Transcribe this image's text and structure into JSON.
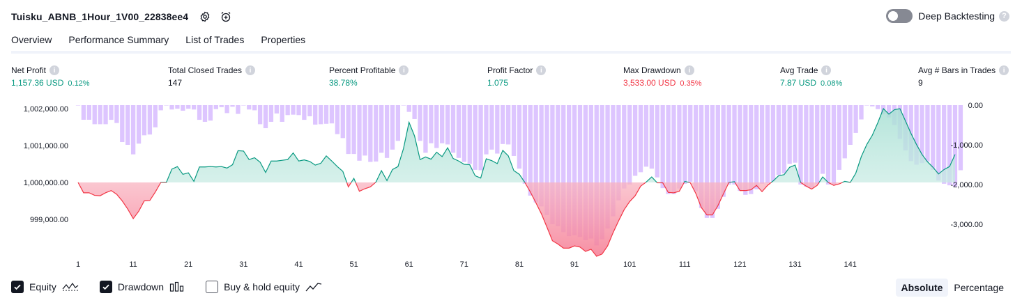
{
  "header": {
    "title": "Tuisku_ABNB_1Hour_1V00_22838ee4",
    "deep_backtesting_label": "Deep Backtesting",
    "info_glyph": "?"
  },
  "tabs": [
    {
      "label": "Overview",
      "active": true
    },
    {
      "label": "Performance Summary",
      "active": false
    },
    {
      "label": "List of Trades",
      "active": false
    },
    {
      "label": "Properties",
      "active": false
    }
  ],
  "metrics": [
    {
      "label": "Net Profit",
      "value": "1,157.36 USD",
      "sub": "0.12%",
      "color": "green"
    },
    {
      "label": "Total Closed Trades",
      "value": "147",
      "sub": "",
      "color": "dark"
    },
    {
      "label": "Percent Profitable",
      "value": "38.78%",
      "sub": "",
      "color": "green"
    },
    {
      "label": "Profit Factor",
      "value": "1.075",
      "sub": "",
      "color": "green"
    },
    {
      "label": "Max Drawdown",
      "value": "3,533.00 USD",
      "sub": "0.35%",
      "color": "red"
    },
    {
      "label": "Avg Trade",
      "value": "7.87 USD",
      "sub": "0.08%",
      "color": "green"
    },
    {
      "label": "Avg # Bars in Trades",
      "value": "9",
      "sub": "",
      "color": "dark"
    }
  ],
  "legend": {
    "equity_label": "Equity",
    "drawdown_label": "Drawdown",
    "buyhold_label": "Buy & hold equity",
    "equity_checked": true,
    "drawdown_checked": true,
    "buyhold_checked": false
  },
  "mode": {
    "absolute_label": "Absolute",
    "percentage_label": "Percentage",
    "active": "Absolute"
  },
  "colors": {
    "equity_up": "#089981",
    "equity_down": "#f23645",
    "equity_fill_up": "#d7f0ea",
    "equity_fill_down": "#f8b8c3",
    "drawdown_bar": "#d5b6ff",
    "text": "#131722"
  },
  "chart_data": {
    "type": "line",
    "title": "",
    "xlabel": "",
    "ylabel": "",
    "x_ticks": [
      "1",
      "11",
      "21",
      "31",
      "41",
      "51",
      "61",
      "71",
      "81",
      "91",
      "101",
      "111",
      "121",
      "131",
      "141"
    ],
    "equity_axis": {
      "ticks": [
        999000,
        1000000,
        1001000,
        1002000
      ],
      "tick_labels": [
        "999,000.00",
        "1,000,000.00",
        "1,001,000.00",
        "1,002,000.00"
      ],
      "ylim": [
        998000,
        1002200
      ]
    },
    "drawdown_axis": {
      "ticks": [
        0,
        -1000,
        -2000,
        -3000
      ],
      "tick_labels": [
        "0.00",
        "-1,000.00",
        "-2,000.00",
        "-3,000.00"
      ],
      "ylim": [
        -3533,
        0
      ]
    },
    "series": [
      {
        "name": "Equity",
        "x_start": 1,
        "values": [
          1000000,
          999720,
          999720,
          999650,
          999640,
          999720,
          999780,
          999680,
          999500,
          999280,
          999020,
          999220,
          999500,
          999510,
          999740,
          1000000,
          1000000,
          1000360,
          1000430,
          1000220,
          1000260,
          1000030,
          1000420,
          1000420,
          1000430,
          1000420,
          1000430,
          1000390,
          1000480,
          1000860,
          1000850,
          1000620,
          1000670,
          1000550,
          1000270,
          1000580,
          1000580,
          1000600,
          1000620,
          1000800,
          1000580,
          1000610,
          1000570,
          1000470,
          1000520,
          1000720,
          1000580,
          1000430,
          1000300,
          999880,
          1000110,
          999760,
          999830,
          999880,
          1000010,
          1000320,
          1000050,
          1000350,
          1000430,
          1000920,
          1001630,
          1001260,
          1000620,
          1000690,
          1000630,
          1000820,
          1000700,
          1000940,
          1000650,
          1000580,
          1000490,
          1000480,
          1000180,
          1000120,
          1000640,
          1000590,
          1000510,
          1000870,
          1000720,
          1000320,
          1000220,
          1000000,
          999740,
          999450,
          999150,
          998790,
          998420,
          998330,
          998220,
          998220,
          998280,
          998250,
          998130,
          998190,
          998000,
          998060,
          998280,
          998640,
          998960,
          999260,
          999480,
          999640,
          999900,
          1000010,
          1000150,
          999990,
          999990,
          999730,
          999720,
          999760,
          1000030,
          999990,
          999700,
          999320,
          999120,
          999120,
          999370,
          999690,
          1000000,
          1000020,
          999780,
          999780,
          999800,
          999920,
          999750,
          999920,
          1000040,
          1000180,
          1000210,
          1000410,
          1000470,
          1000000,
          999900,
          999820,
          999920,
          1000150,
          1000000,
          999920,
          999960,
          1000030,
          1000000,
          1000250,
          1000700,
          1001030,
          1001280,
          1001620,
          1002000,
          1001850,
          1001970,
          1002000,
          1001670,
          1001330,
          1001030,
          1000760,
          1000560,
          1000410,
          1000230,
          1000350,
          1000430,
          1000760
        ]
      },
      {
        "name": "Drawdown",
        "x_start": 1,
        "values": [
          0,
          -368,
          -368,
          -480,
          -480,
          -480,
          -370,
          -450,
          -930,
          -1000,
          -1240,
          -970,
          -760,
          -740,
          -560,
          -130,
          0,
          -110,
          -90,
          -140,
          -90,
          -110,
          -370,
          -420,
          -390,
          -100,
          -50,
          -200,
          -40,
          -220,
          0,
          -110,
          -130,
          -480,
          -580,
          -420,
          -210,
          -420,
          -250,
          -240,
          -250,
          -370,
          -280,
          -490,
          -480,
          -470,
          -460,
          -730,
          -830,
          -1230,
          -1230,
          -1400,
          -1270,
          -1430,
          -1420,
          -1200,
          -1330,
          -1120,
          -900,
          0,
          -170,
          -350,
          -900,
          -1200,
          -960,
          -1080,
          -960,
          -990,
          -1200,
          -1330,
          -1430,
          -1480,
          -1630,
          -1640,
          -1240,
          -1120,
          -1220,
          -980,
          -990,
          -1280,
          -1600,
          -1980,
          -2280,
          -2450,
          -2550,
          -2770,
          -3000,
          -3050,
          -3200,
          -3300,
          -3280,
          -3320,
          -3400,
          -3360,
          -3533,
          -3380,
          -3110,
          -2800,
          -2400,
          -2100,
          -2000,
          -1780,
          -1690,
          -1550,
          -1600,
          -1820,
          -2090,
          -2240,
          -2240,
          -2100,
          -1980,
          -1930,
          -2170,
          -2590,
          -2840,
          -2840,
          -2610,
          -2310,
          -2000,
          -2000,
          -2160,
          -2260,
          -2240,
          -2120,
          -1980,
          -1960,
          -1920,
          -1760,
          -1720,
          -1480,
          -1450,
          -2000,
          -2050,
          -2080,
          -1990,
          -1730,
          -2000,
          -2000,
          -1630,
          -1340,
          -1000,
          -700,
          -360,
          0,
          -30,
          -100,
          -230,
          -310,
          -500,
          -850,
          -1140,
          -1410,
          -1500,
          -1460,
          -1420,
          -1630,
          -1900,
          -1980,
          -2020,
          -2050,
          -1640
        ]
      }
    ]
  }
}
